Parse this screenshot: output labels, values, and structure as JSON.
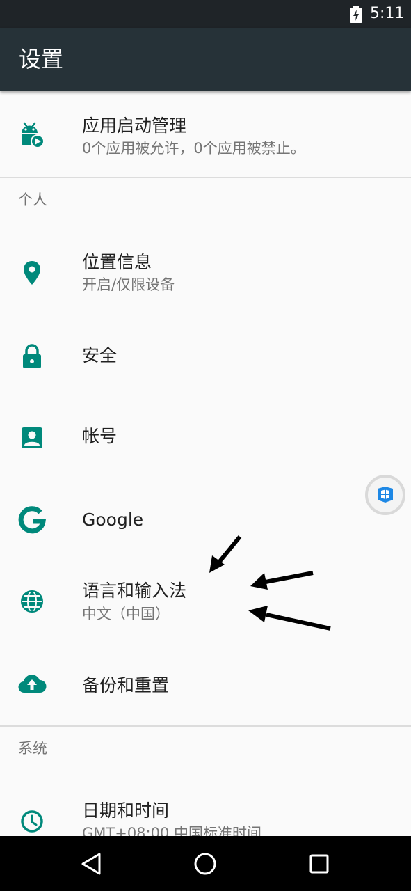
{
  "status_bar": {
    "time": "5:11"
  },
  "toolbar": {
    "title": "设置"
  },
  "top_item": {
    "title": "应用启动管理",
    "subtitle": "0个应用被允许，0个应用被禁止。",
    "icon": "android-play-icon"
  },
  "personal": {
    "header": "个人",
    "items": [
      {
        "title": "位置信息",
        "subtitle": "开启/仅限设备",
        "icon": "location-pin-icon"
      },
      {
        "title": "安全",
        "icon": "lock-icon"
      },
      {
        "title": "帐号",
        "icon": "account-box-icon"
      },
      {
        "title": "Google",
        "icon": "google-g-icon"
      },
      {
        "title": "语言和输入法",
        "subtitle": "中文（中国）",
        "icon": "globe-icon"
      },
      {
        "title": "备份和重置",
        "icon": "cloud-upload-icon"
      }
    ]
  },
  "system": {
    "header": "系统",
    "items": [
      {
        "title": "日期和时间",
        "subtitle": "GMT+08:00 中国标准时间",
        "icon": "clock-icon"
      }
    ]
  },
  "colors": {
    "accent": "#00897b",
    "toolbar": "#263238",
    "status_bar": "#1f2428",
    "background": "#fafafa"
  }
}
